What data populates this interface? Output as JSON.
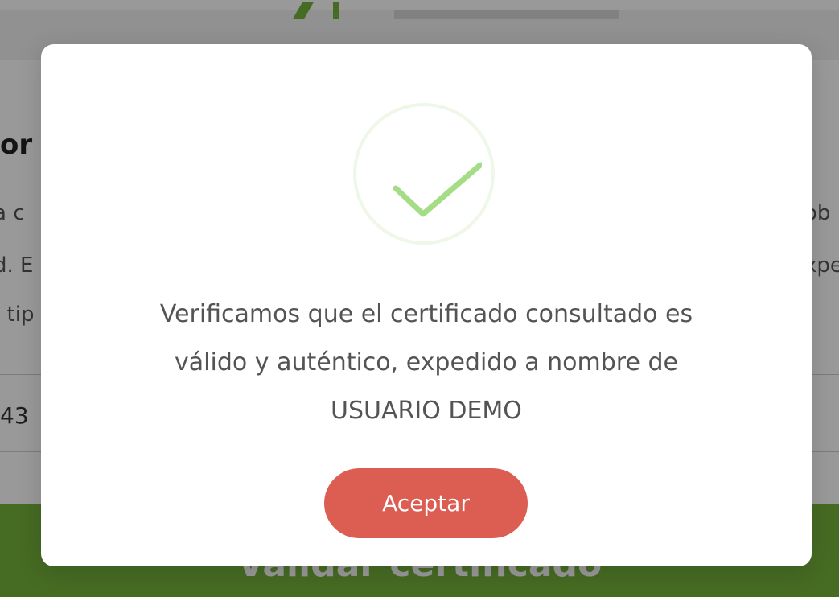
{
  "background": {
    "section_title": "or",
    "line_1_left": "a c",
    "line_2_left": "d. E",
    "line_3_left": ". tip",
    "line_1_right": "ob",
    "line_2_right": "xpe",
    "input_value": "43",
    "validate_button_label": "Validar certificado",
    "brand_color": "#76b23b"
  },
  "dialog": {
    "icon": "success-check-icon",
    "icon_color": "#a5dc86",
    "message_lines": [
      "Verificamos que el certificado consultado es",
      "válido y auténtico, expedido a nombre de",
      "USUARIO DEMO"
    ],
    "accept_label": "Aceptar",
    "accept_color": "#dc5e52"
  }
}
